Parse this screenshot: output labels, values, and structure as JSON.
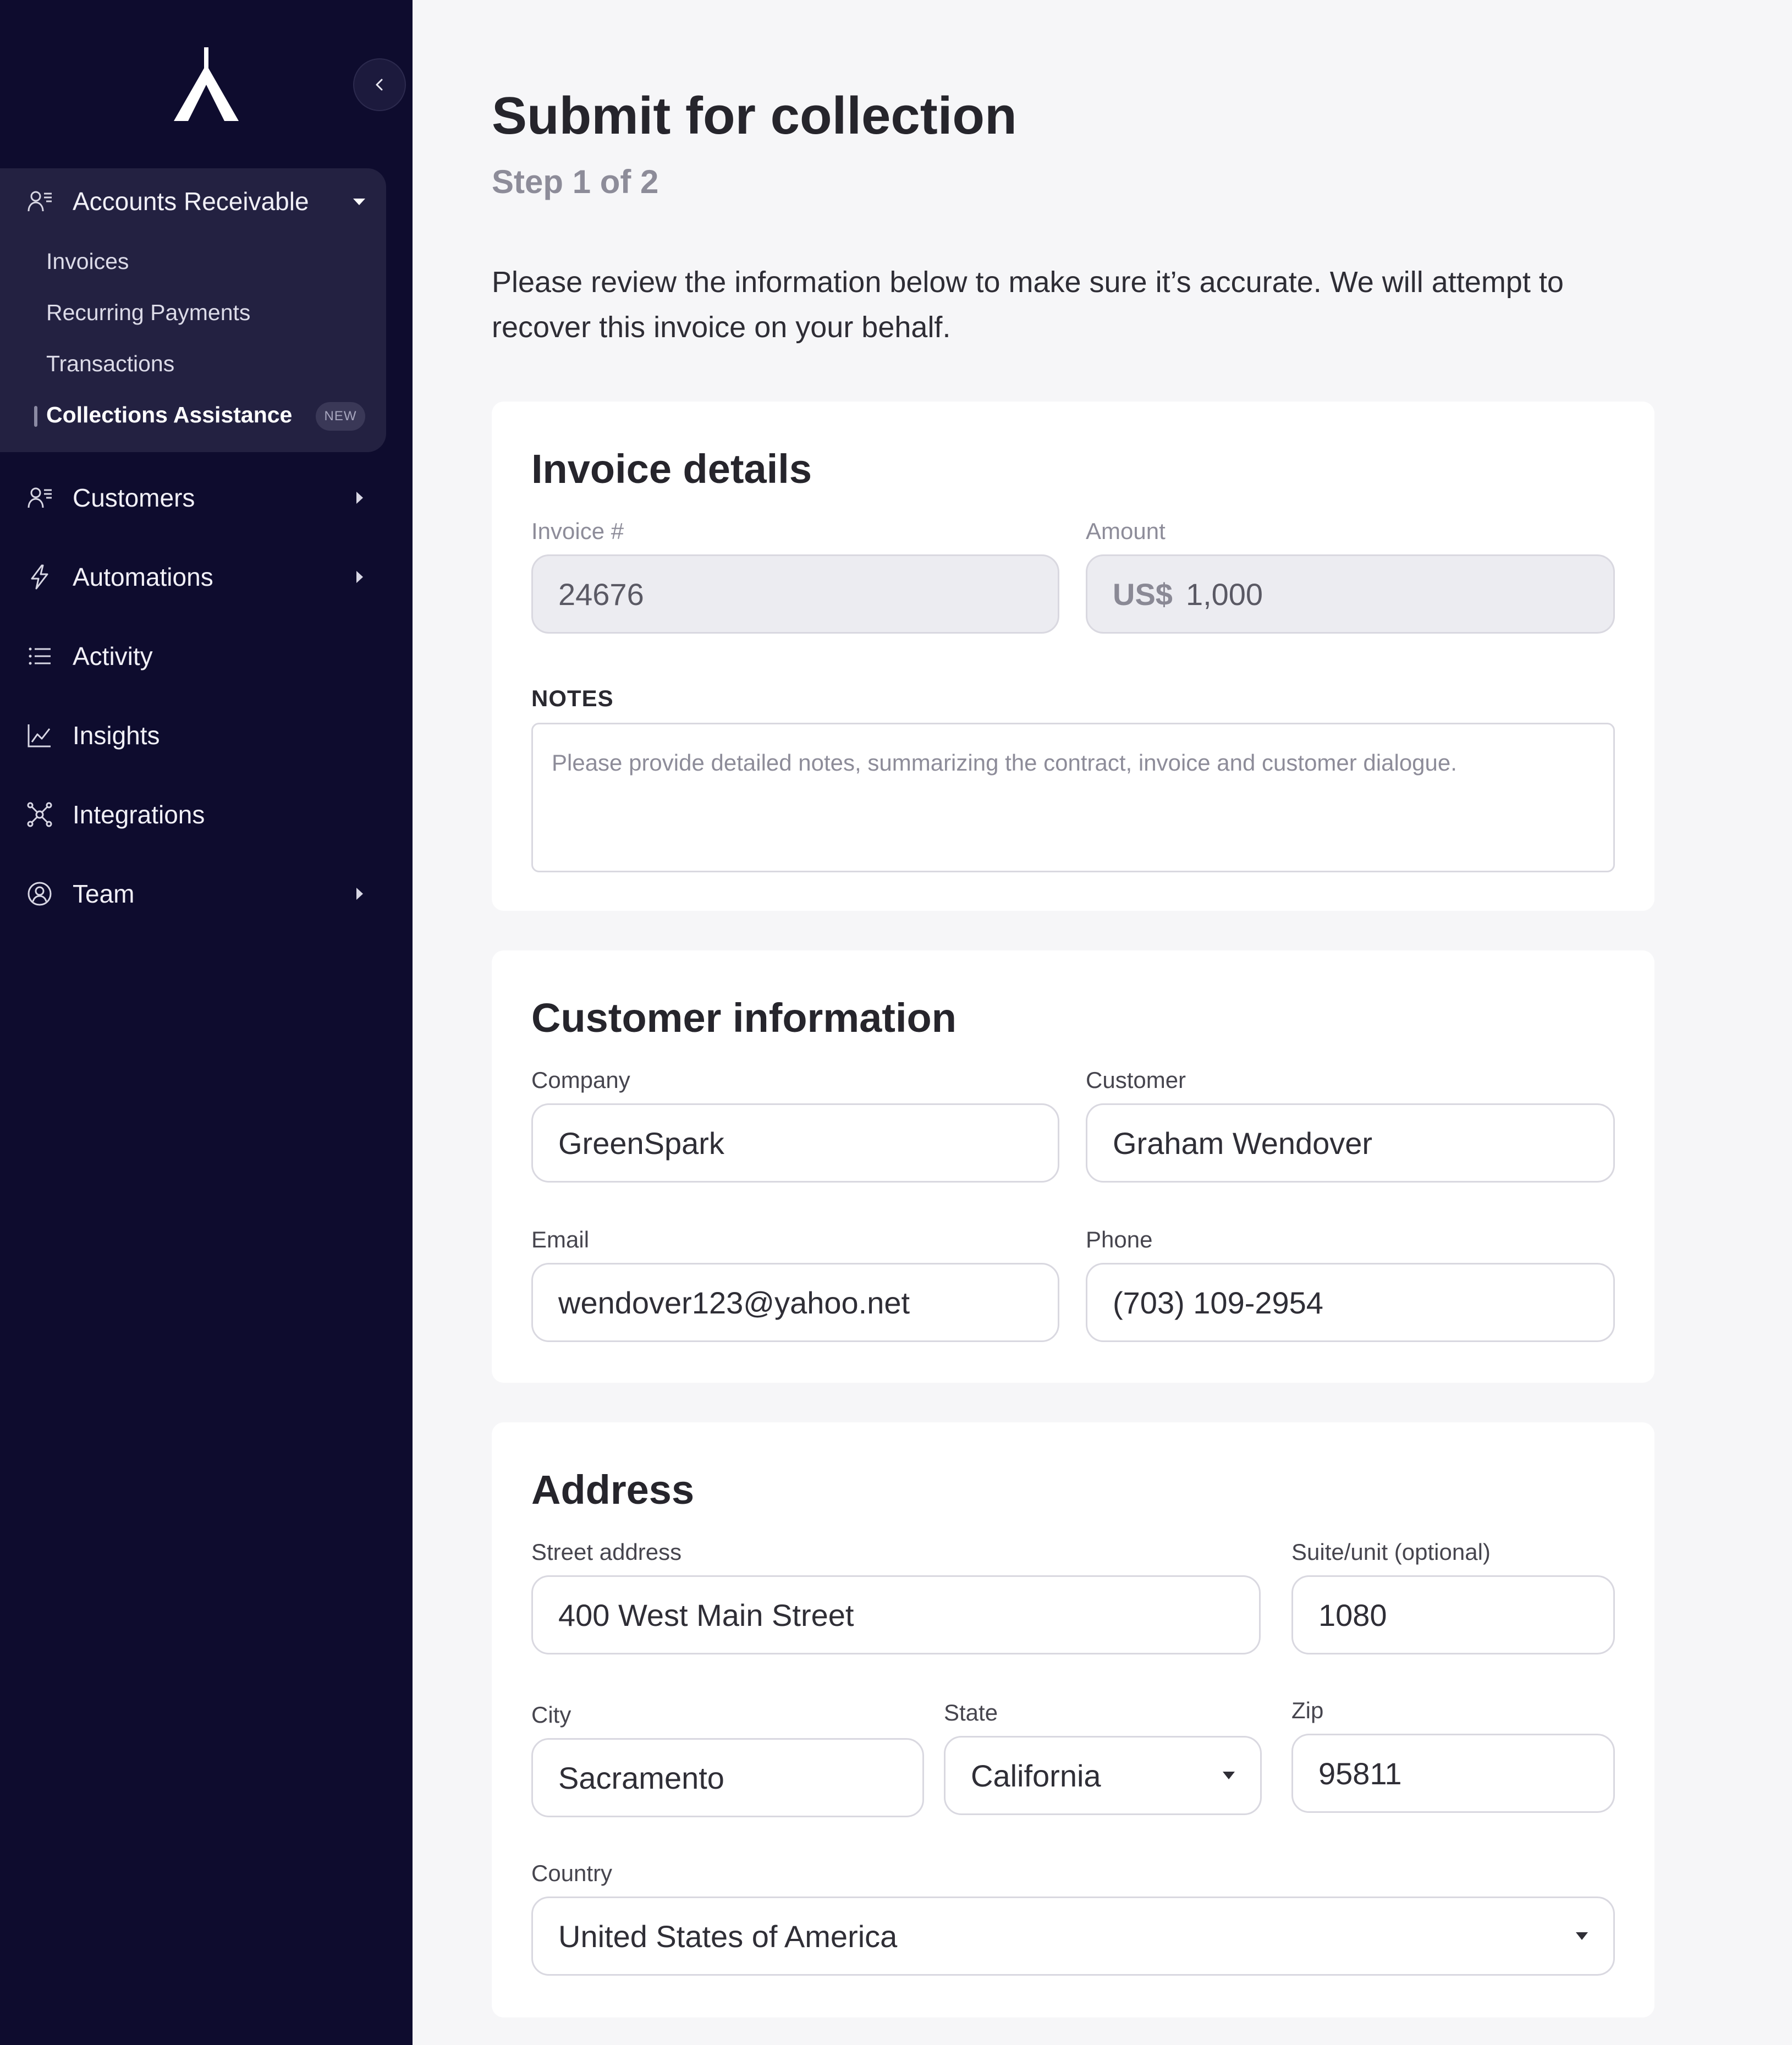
{
  "sidebar": {
    "group": {
      "label": "Accounts Receivable",
      "items": [
        "Invoices",
        "Recurring Payments",
        "Transactions",
        "Collections Assistance"
      ],
      "badge": "NEW"
    },
    "nav": [
      "Customers",
      "Automations",
      "Activity",
      "Insights",
      "Integrations",
      "Team"
    ]
  },
  "header": {
    "title": "Submit for collection",
    "step": "Step 1 of 2",
    "intro": "Please review the information below to make sure it’s accurate. We will attempt to recover this invoice on your behalf."
  },
  "invoice": {
    "title": "Invoice details",
    "number_label": "Invoice #",
    "number": "24676",
    "amount_label": "Amount",
    "currency": "US$",
    "amount": "1,000",
    "notes_label": "NOTES",
    "notes_placeholder": "Please provide detailed notes, summarizing the contract, invoice and customer dialogue."
  },
  "customer": {
    "title": "Customer information",
    "company_label": "Company",
    "company": "GreenSpark",
    "customer_label": "Customer",
    "customer": "Graham Wendover",
    "email_label": "Email",
    "email": "wendover123@yahoo.net",
    "phone_label": "Phone",
    "phone": "(703) 109-2954"
  },
  "address": {
    "title": "Address",
    "street_label": "Street address",
    "street": "400 West Main Street",
    "suite_label": "Suite/unit (optional)",
    "suite": "1080",
    "city_label": "City",
    "city": "Sacramento",
    "state_label": "State",
    "state": "California",
    "zip_label": "Zip",
    "zip": "95811",
    "country_label": "Country",
    "country": "United States of America"
  },
  "colors": {
    "sidebar_bg": "#0e0c2e",
    "page_bg": "#f6f6f8",
    "card_bg": "#ffffff"
  }
}
